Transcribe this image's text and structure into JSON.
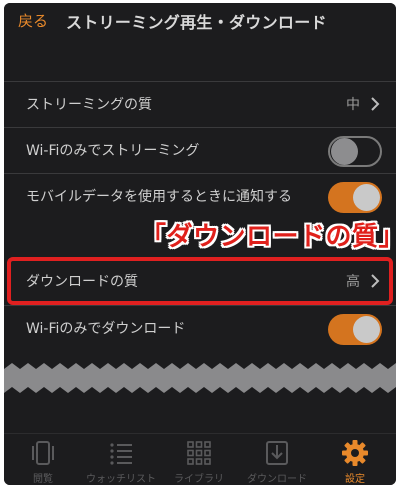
{
  "nav": {
    "back_label": "戻る",
    "title": "ストリーミング再生・ダウンロード"
  },
  "streaming": {
    "quality_label": "ストリーミングの質",
    "quality_value": "中",
    "wifi_only_label": "Wi-Fiのみでストリーミング",
    "wifi_only_on": false,
    "mobile_notify_label": "モバイルデータを使用するときに通知する",
    "mobile_notify_on": true
  },
  "download": {
    "quality_label": "ダウンロードの質",
    "quality_value": "高",
    "wifi_only_label": "Wi-Fiのみでダウンロード",
    "wifi_only_on": true
  },
  "annotation": {
    "callout": "「ダウンロードの質」"
  },
  "tabs": [
    {
      "label": "閲覧",
      "icon": "browse-icon",
      "active": false
    },
    {
      "label": "ウォッチリスト",
      "icon": "watchlist-icon",
      "active": false
    },
    {
      "label": "ライブラリ",
      "icon": "library-icon",
      "active": false
    },
    {
      "label": "ダウンロード",
      "icon": "download-icon",
      "active": false
    },
    {
      "label": "設定",
      "icon": "gear-icon",
      "active": true
    }
  ],
  "colors": {
    "accent": "#e8892b",
    "toggle_on": "#d4741f",
    "background": "#1c1c1e",
    "highlight": "#e02020"
  }
}
